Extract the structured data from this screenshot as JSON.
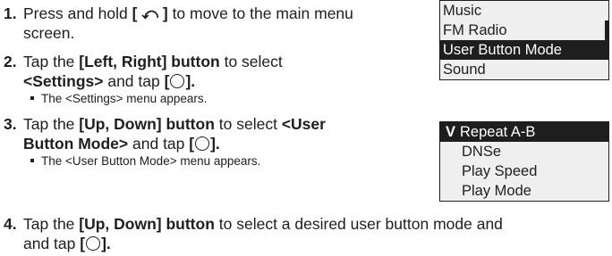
{
  "steps": [
    {
      "num": "1.",
      "line1_a": "Press and hold ",
      "key": "[ ⤺ ]",
      "line1_b": " to move to the main menu",
      "line2": "screen."
    },
    {
      "num": "2.",
      "line1_a": "Tap the ",
      "line1_b": "[Left, Right] button",
      "line1_c": " to select",
      "line2_a": "<Settings>",
      "line2_b": " and tap ",
      "tap_open": "[",
      "tap_close": "].",
      "sub": "The <Settings> menu appears."
    },
    {
      "num": "3.",
      "line1_a": "Tap the ",
      "line1_b": "[Up, Down] button",
      "line1_c": " to select ",
      "line1_d": "<User",
      "line2_a": "Button Mode>",
      "line2_b": " and tap ",
      "tap_open": "[",
      "tap_close": "].",
      "sub": "The <User Button Mode> menu appears."
    },
    {
      "num": "4.",
      "line1_a": "Tap the ",
      "line1_b": "[Up, Down] button",
      "line1_c": " to select a desired user button mode and",
      "line2_a": "and tap ",
      "tap_open": "[",
      "tap_close": "]."
    }
  ],
  "main_menu": {
    "items": [
      "Music",
      "FM Radio",
      "User Button Mode",
      "Sound"
    ],
    "selected": "User Button Mode"
  },
  "user_button_menu": {
    "check_mark": "V",
    "items": [
      "Repeat A-B",
      "DNSe",
      "Play Speed",
      "Play Mode"
    ],
    "selected": "Repeat A-B"
  },
  "icons": {
    "back": "back-arrow-icon",
    "select": "circle-button-icon"
  }
}
